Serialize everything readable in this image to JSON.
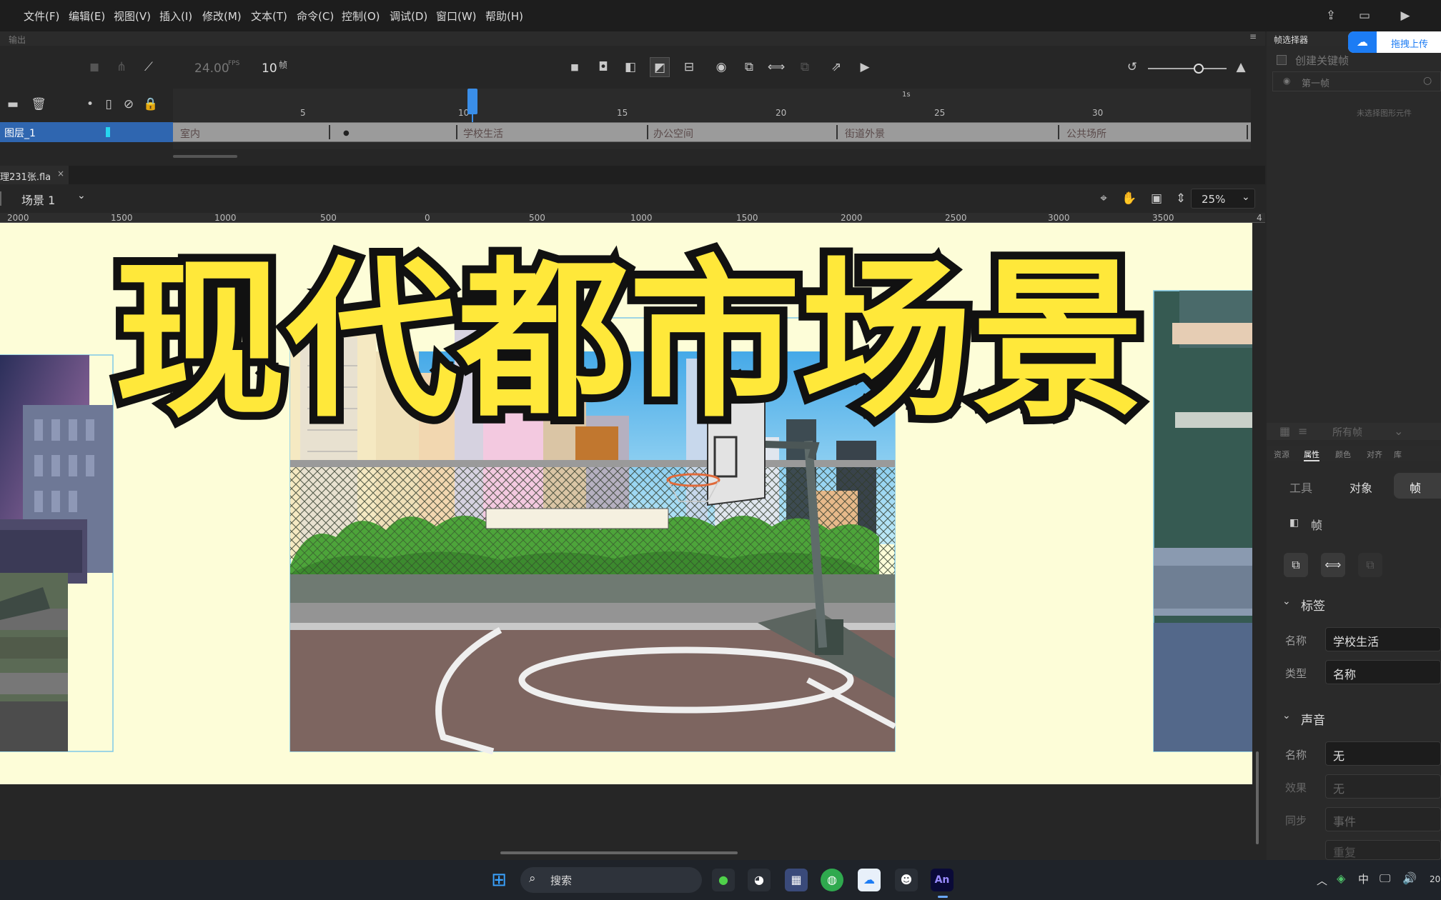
{
  "menubar": {
    "items": [
      "文件(F)",
      "编辑(E)",
      "视图(V)",
      "插入(I)",
      "修改(M)",
      "文本(T)",
      "命令(C)",
      "控制(O)",
      "调试(D)",
      "窗口(W)",
      "帮助(H)"
    ]
  },
  "timeline": {
    "panel_label": "输出",
    "fps": "24.00",
    "fps_unit": "FPS",
    "current_frame": "10",
    "frame_unit": "帧",
    "ruler_ticks": [
      "5",
      "10",
      "15",
      "20",
      "25",
      "30"
    ],
    "ruler_second_mark": "1s",
    "layer_name": "图层_1",
    "frame_labels": [
      "室内",
      "学校生活",
      "办公空间",
      "街道外景",
      "公共场所"
    ]
  },
  "document": {
    "tab": "理231张.fla",
    "scene": "场景 1",
    "zoom": "25%",
    "ruler_labels": [
      "2000",
      "1500",
      "1000",
      "500",
      "0",
      "500",
      "1000",
      "1500",
      "2000",
      "2500",
      "3000",
      "3500",
      "4"
    ]
  },
  "stage": {
    "title_overlay": "现代都市场景"
  },
  "right_panel": {
    "frame_picker_title": "帧选择器",
    "upload_button": "拖拽上传",
    "create_keyframe": "创建关键帧",
    "first_frame": "第一帧",
    "no_symbol": "未选择图形元件",
    "all_frames": "所有帧",
    "panel_tabs": [
      "资源",
      "属性",
      "颜色",
      "对齐",
      "库"
    ],
    "subtabs": [
      "工具",
      "对象",
      "帧"
    ],
    "frame_section": "帧",
    "label_section": "标签",
    "label_name_label": "名称",
    "label_name_value": "学校生活",
    "label_type_label": "类型",
    "label_type_value": "名称",
    "sound_section": "声音",
    "sound_name_label": "名称",
    "sound_name_value": "无",
    "sound_effect_label": "效果",
    "sound_effect_value": "无",
    "sound_sync_label": "同步",
    "sound_sync_value": "事件",
    "sound_repeat_value": "重复"
  },
  "taskbar": {
    "search_placeholder": "搜索",
    "ime": "中",
    "clock_partial": "20"
  },
  "colors": {
    "accent": "#2f66b0",
    "stage_bg": "#fdfdd8",
    "title_fill": "#ffe83a",
    "title_stroke": "#111111",
    "playhead": "#3a8ee8"
  }
}
